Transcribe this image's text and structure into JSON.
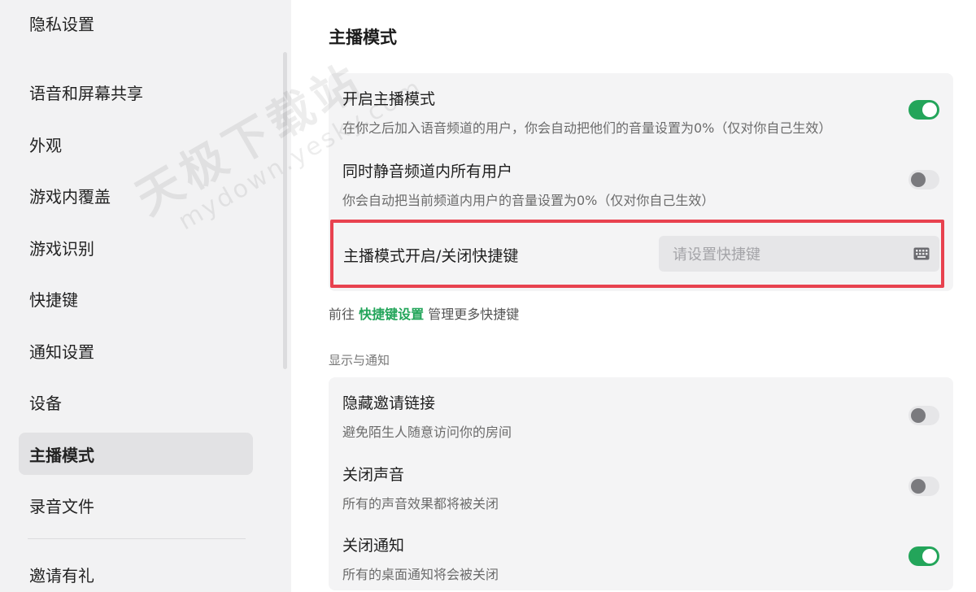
{
  "sidebar": {
    "items": [
      {
        "label": "隐私设置"
      },
      {
        "label": "语音和屏幕共享"
      },
      {
        "label": "外观"
      },
      {
        "label": "游戏内覆盖"
      },
      {
        "label": "游戏识别"
      },
      {
        "label": "快捷键"
      },
      {
        "label": "通知设置"
      },
      {
        "label": "设备"
      },
      {
        "label": "主播模式"
      },
      {
        "label": "录音文件"
      },
      {
        "label": "邀请有礼"
      }
    ],
    "active_index": 8
  },
  "main": {
    "title": "主播模式",
    "streamer_settings": [
      {
        "title": "开启主播模式",
        "desc": "在你之后加入语音频道的用户，你会自动把他们的音量设置为0%（仅对你自己生效）",
        "enabled": true
      },
      {
        "title": "同时静音频道内所有用户",
        "desc": "你会自动把当前频道内用户的音量设置为0%（仅对你自己生效）",
        "enabled": false
      }
    ],
    "shortcut": {
      "label": "主播模式开启/关闭快捷键",
      "placeholder": "请设置快捷键",
      "icon": "keyboard-icon"
    },
    "hint": {
      "prefix": "前往",
      "link": "快捷键设置",
      "suffix": "管理更多快捷键"
    },
    "section_label": "显示与通知",
    "display_settings": [
      {
        "title": "隐藏邀请链接",
        "desc": "避免陌生人随意访问你的房间",
        "enabled": false
      },
      {
        "title": "关闭声音",
        "desc": "所有的声音效果都将被关闭",
        "enabled": false
      },
      {
        "title": "关闭通知",
        "desc": "所有的桌面通知将会被关闭",
        "enabled": true
      }
    ]
  },
  "watermark": {
    "line1": "天极下载站",
    "line2": "mydown.yesky.com"
  },
  "colors": {
    "accent_green": "#23a55a",
    "highlight_red": "#e8424f",
    "sidebar_bg": "#f2f2f3",
    "card_bg": "#f4f4f5"
  }
}
